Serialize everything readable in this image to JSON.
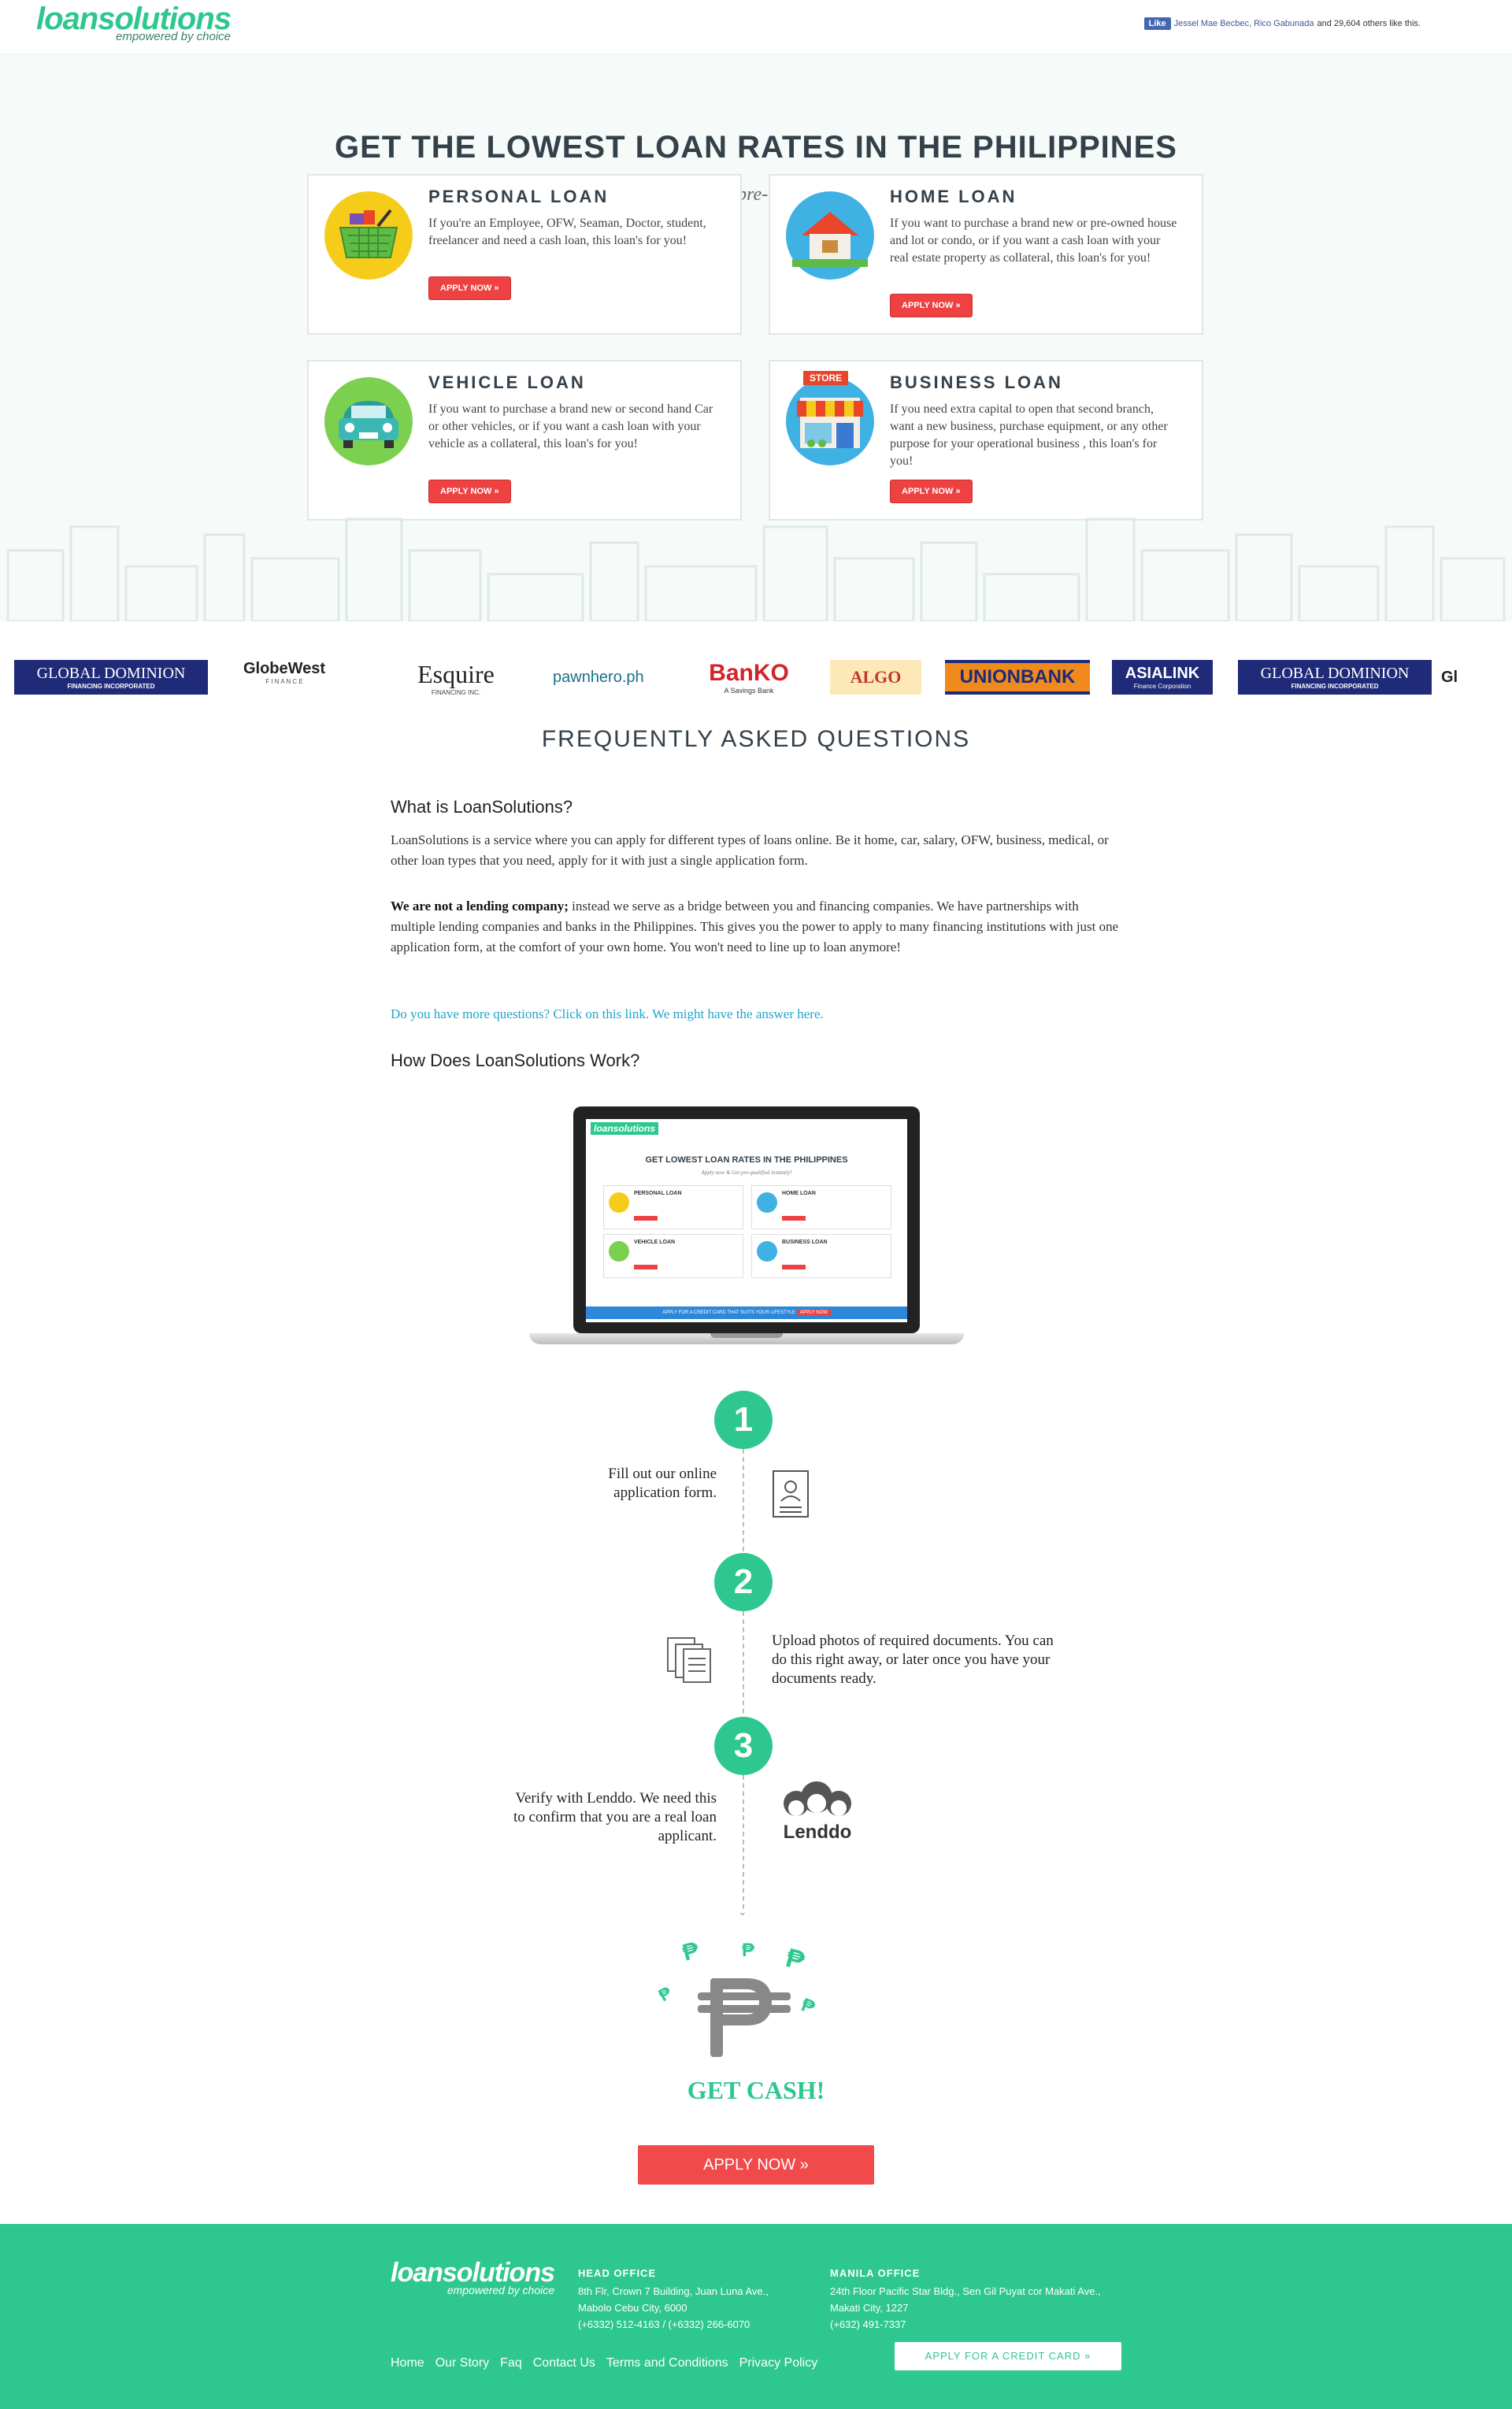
{
  "header": {
    "logo_word": "loansolutions",
    "logo_tag": "empowered by choice",
    "fb_like": "Like",
    "fb_names": "Jessel Mae Becbec, Rico Gabunada",
    "fb_rest": "and 29,604 others like this."
  },
  "hero": {
    "title": "GET THE LOWEST LOAN RATES IN THE PHILIPPINES",
    "subtitle": "Apply now & Get pre-qualified instantly!",
    "cards": [
      {
        "title": "PERSONAL LOAN",
        "desc": "If you're an Employee, OFW, Seaman, Doctor, student, freelancer and need a cash loan, this loan's for you!",
        "button": "APPLY NOW »"
      },
      {
        "title": "HOME LOAN",
        "desc": "If you want to purchase a brand new or pre-owned house and lot or condo, or if you want a cash loan with your real estate property as collateral, this loan's for you!",
        "button": "APPLY NOW »"
      },
      {
        "title": "VEHICLE LOAN",
        "desc": "If you want to purchase a brand new or second hand Car or other vehicles, or if you want a cash loan with your vehicle as a collateral, this loan's for you!",
        "button": "APPLY NOW »"
      },
      {
        "title": "BUSINESS LOAN",
        "desc": "If you need extra capital to open that second branch, want a new business, purchase equipment, or any other purpose for your operational business , this loan's for you!",
        "button": "APPLY NOW »"
      }
    ],
    "store_sign": "STORE"
  },
  "partners": [
    "GLOBAL DOMINION",
    "GlobeWest",
    "Esquire",
    "pawnhero.ph",
    "BanKO",
    "ALGO",
    "UNIONBANK",
    "ASIALINK",
    "GLOBAL DOMINION",
    "Gl"
  ],
  "partner_subs": {
    "global": "FINANCING INCORPORATED",
    "globewest": "F I N A N C E",
    "esquire": "FINANCING INC.",
    "banko": "A Savings Bank",
    "asialink": "Finance Corporation"
  },
  "faq": {
    "title": "FREQUENTLY ASKED QUESTIONS",
    "q1": "What is LoanSolutions?",
    "a1": "LoanSolutions is a service where you can apply for different types of loans online. Be it home, car, salary, OFW, business, medical, or other loan types that you need, apply for it with just a single application form.",
    "a2_bold": "We are not a lending company;",
    "a2_rest": " instead we serve as a bridge between you and financing companies. We have partnerships with multiple lending companies and banks in the Philippines. This gives you the power to apply to many financing institutions with just one application form, at the comfort of your own home. You won't need to line up to loan anymore!",
    "link": "Do you have more questions? Click on this link. We might have the answer here.",
    "q2": "How Does LoanSolutions Work?"
  },
  "laptop_screen": {
    "logo": "loansolutions",
    "title": "GET LOWEST LOAN RATES IN THE PHILIPPINES",
    "sub": "Apply now & Get pre-qualified instantly!",
    "cards": [
      "PERSONAL LOAN",
      "HOME LOAN",
      "VEHICLE LOAN",
      "BUSINESS LOAN"
    ],
    "banner": "APPLY FOR A CREDIT CARD THAT SUITS YOUR LIFESTYLE",
    "banner_btn": "APPLY NOW"
  },
  "steps": [
    {
      "num": "1",
      "text": "Fill out our online application form."
    },
    {
      "num": "2",
      "text": "Upload photos of required documents. You can do this right away, or later once you have your documents ready."
    },
    {
      "num": "3",
      "text": "Verify with Lenddo. We need this to confirm that you are a real loan applicant."
    }
  ],
  "lenddo": "Lenddo",
  "get_cash": "GET CASH!",
  "apply_now": "APPLY NOW »",
  "footer": {
    "logo_word": "loansolutions",
    "logo_tag": "empowered by choice",
    "head_office_title": "HEAD OFFICE",
    "head_office_lines": [
      "8th Flr, Crown 7 Building, Juan Luna Ave.,",
      "Mabolo Cebu City, 6000",
      "(+6332) 512-4163 / (+6332) 266-6070"
    ],
    "manila_office_title": "MANILA OFFICE",
    "manila_office_lines": [
      "24th Floor Pacific Star Bldg., Sen Gil Puyat cor Makati Ave.,",
      "Makati City, 1227",
      "(+632) 491-7337"
    ],
    "links": [
      "Home",
      "Our Story",
      "Faq",
      "Contact Us",
      "Terms and Conditions",
      "Privacy Policy"
    ],
    "credit_card_btn": "APPLY FOR A CREDIT CARD »"
  },
  "colors": {
    "brand": "#2ec78f",
    "button": "#ee4242",
    "title": "#34404a",
    "link": "#1fa5c9"
  }
}
